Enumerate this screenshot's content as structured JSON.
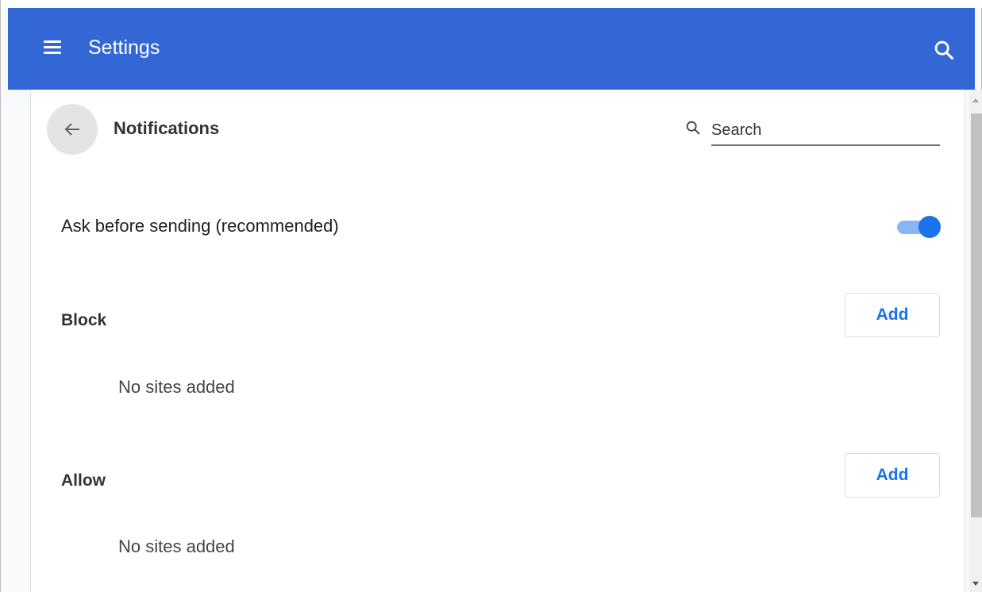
{
  "header": {
    "title": "Settings",
    "menu_icon": "hamburger-menu-icon",
    "search_icon": "search-icon",
    "bg_color": "#3367d6"
  },
  "page": {
    "back_icon": "arrow-back-icon",
    "title": "Notifications",
    "search_icon": "search-icon",
    "search_placeholder": "Search"
  },
  "settings": {
    "ask_before_sending": {
      "label": "Ask before sending (recommended)",
      "enabled": true,
      "accent_color": "#1a73e8"
    }
  },
  "sections": {
    "block": {
      "title": "Block",
      "add_label": "Add",
      "empty_text": "No sites added"
    },
    "allow": {
      "title": "Allow",
      "add_label": "Add",
      "empty_text": "No sites added"
    }
  }
}
